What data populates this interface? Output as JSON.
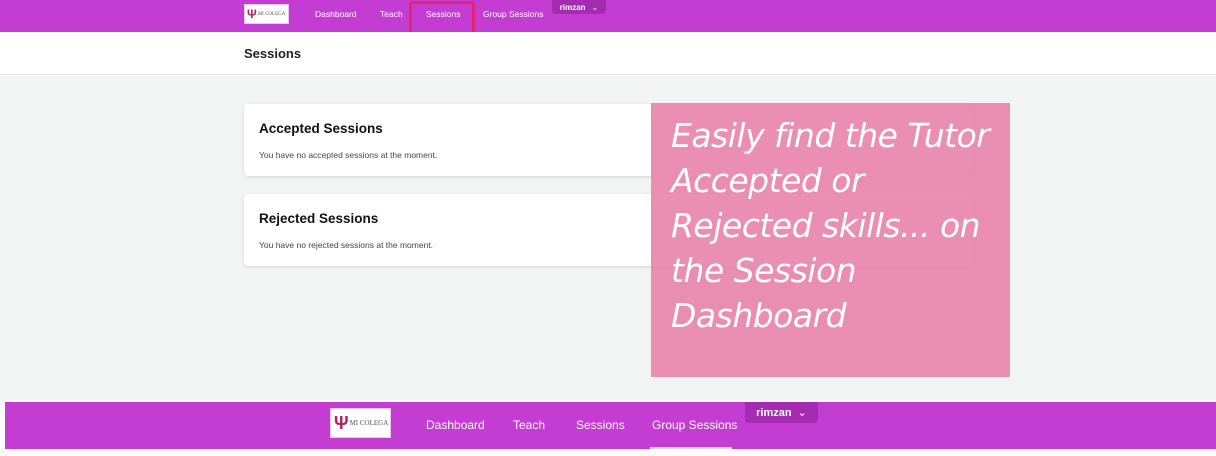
{
  "brand": {
    "logo_text": "MI COLEGA",
    "accent": "#c43dd2",
    "user_button_color": "#a52bb3",
    "highlight_color": "#e8226e"
  },
  "nav": {
    "links": [
      "Dashboard",
      "Teach",
      "Sessions",
      "Group Sessions"
    ],
    "active": "Sessions",
    "user": "rimzan",
    "user_icon": "chevron-down-icon"
  },
  "page": {
    "title": "Sessions"
  },
  "sections": [
    {
      "title": "Accepted Sessions",
      "message": "You have no accepted sessions at the moment."
    },
    {
      "title": "Rejected Sessions",
      "message": "You have no rejected sessions at the moment."
    }
  ],
  "overlay": {
    "text": "Easily find the Tutor Accepted or Rejected skills... on the Session Dashboard",
    "color": "#e882aa"
  }
}
